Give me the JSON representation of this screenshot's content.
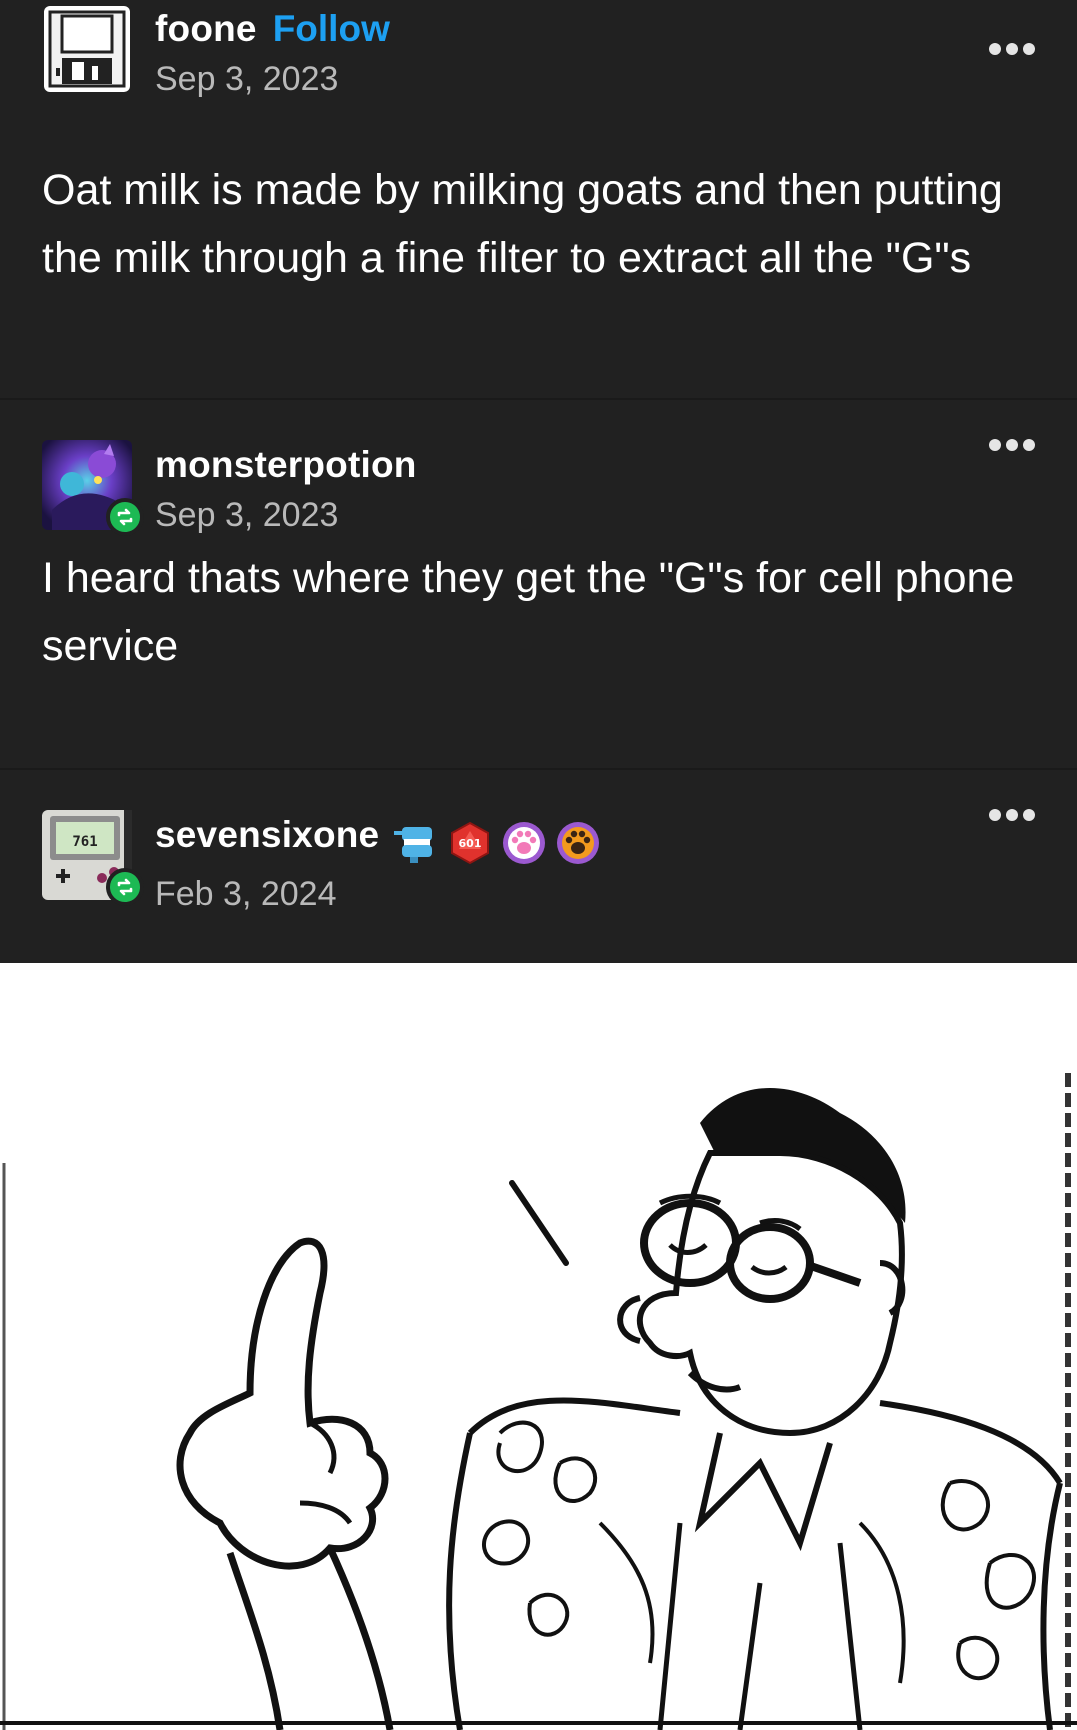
{
  "posts": [
    {
      "username": "foone",
      "follow_label": "Follow",
      "date": "Sep 3, 2023",
      "text": "Oat milk is made by milking goats and then putting the milk through a fine filter to extract all the \"G\"s",
      "avatar_icon": "floppy-disk-icon",
      "more_icon": "more-options-icon"
    },
    {
      "username": "monsterpotion",
      "date": "Sep 3, 2023",
      "text": "I heard thats where they get the \"G\"s for cell phone service",
      "avatar_icon": "purple-creature-avatar",
      "reblog_icon": "reblog-icon",
      "more_icon": "more-options-icon"
    },
    {
      "username": "sevensixone",
      "date": "Feb 3, 2024",
      "avatar_icon": "gameboy-avatar",
      "avatar_screen_text": "761",
      "reblog_icon": "reblog-icon",
      "badges": [
        "chattering-teeth-badge",
        "d20-dice-badge",
        "pink-paw-badge",
        "orange-paw-badge"
      ],
      "d20_text": "601",
      "more_icon": "more-options-icon"
    }
  ],
  "image": {
    "description_icon": "comic-panel-man-pointing-up"
  },
  "colors": {
    "background": "#212121",
    "follow": "#1da0f2",
    "reblog": "#1db954",
    "date": "#b9b9b9"
  }
}
